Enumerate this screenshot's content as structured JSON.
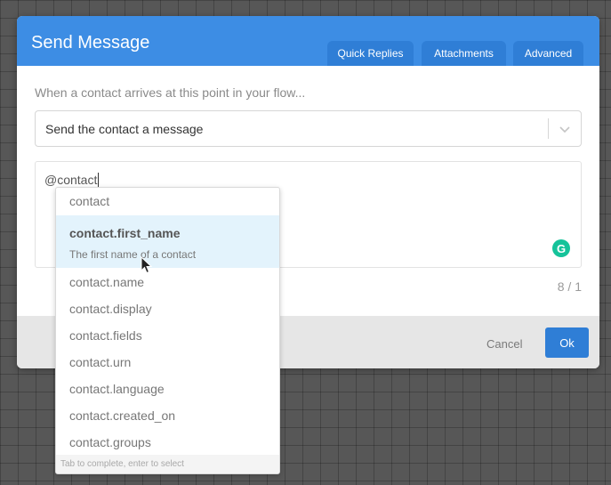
{
  "modal": {
    "title": "Send Message",
    "tabs": [
      "Quick Replies",
      "Attachments",
      "Advanced"
    ]
  },
  "form": {
    "prompt": "When a contact arrives at this point in your flow...",
    "action_select": {
      "value": "Send the contact a message",
      "icon": "chevron-down-icon"
    },
    "message_text": "@contact",
    "char_counter": "8 / 1",
    "grammarly_icon": "G"
  },
  "footer": {
    "cancel_label": "Cancel",
    "ok_label": "Ok"
  },
  "autocomplete": {
    "first_option": "contact",
    "selected": {
      "name": "contact.first_name",
      "description": "The first name of a contact"
    },
    "options": [
      "contact.name",
      "contact.display",
      "contact.fields",
      "contact.urn",
      "contact.language",
      "contact.created_on",
      "contact.groups"
    ],
    "hint": "Tab to complete, enter to select"
  },
  "colors": {
    "header": "#3d8de4",
    "tab": "#2f7ed6",
    "ok_button": "#2f7ed6",
    "selected_option": "#e3f3fc",
    "grammarly": "#15c39a"
  }
}
